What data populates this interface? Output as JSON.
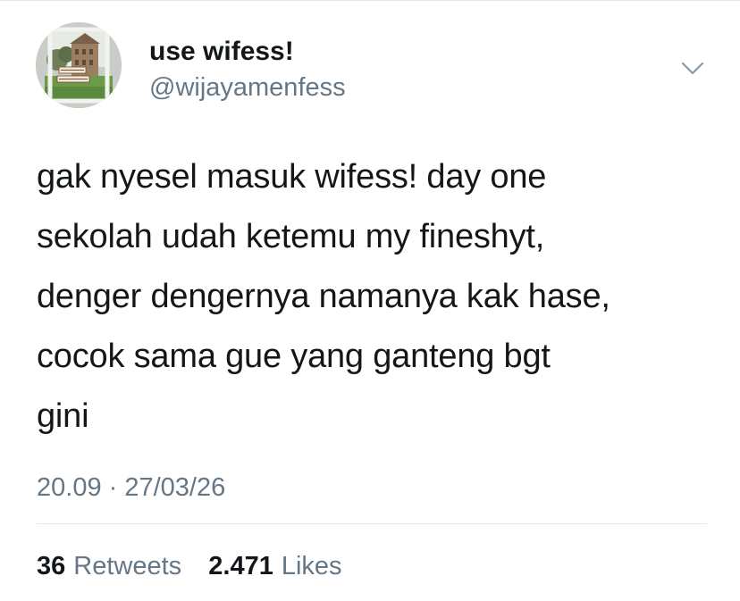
{
  "author": {
    "display_name": "use wifess!",
    "username": "@wijayamenfess",
    "avatar_icon": "campus-building-photo-avatar"
  },
  "tweet": {
    "text": "gak nyesel masuk wifess! day one\nsekolah udah ketemu my fineshyt,\ndenger dengernya namanya kak hase,\ncocok sama gue yang ganteng bgt\ngini",
    "meta": "20.09 · 27/03/26"
  },
  "stats": {
    "retweets_count": "36",
    "retweets_label": "Retweets",
    "likes_count": "2.471",
    "likes_label": "Likes"
  },
  "colors": {
    "text_primary": "#14171a",
    "text_secondary": "#657786",
    "divider": "#e1e8ed"
  },
  "icons": {
    "more_menu": "chevron-down-icon"
  }
}
